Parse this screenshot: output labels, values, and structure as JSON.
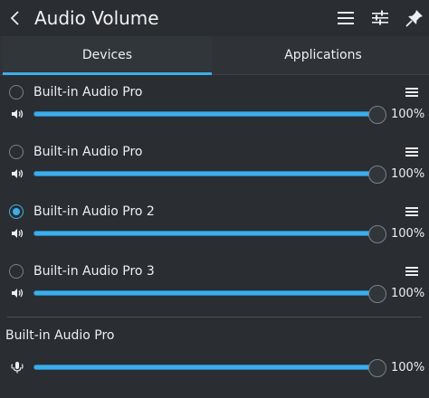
{
  "header": {
    "title": "Audio Volume",
    "back_icon": "chevron-left-icon",
    "actions": [
      {
        "icon": "hamburger-menu-icon"
      },
      {
        "icon": "settings-sliders-icon"
      },
      {
        "icon": "pin-icon"
      }
    ]
  },
  "tabs": [
    {
      "label": "Devices",
      "active": true
    },
    {
      "label": "Applications",
      "active": false
    }
  ],
  "devices": [
    {
      "name": "Built-in Audio Pro",
      "selected": false,
      "volume_percent": 100,
      "volume_label": "100%",
      "icon": "speaker-icon"
    },
    {
      "name": "Built-in Audio Pro",
      "selected": false,
      "volume_percent": 100,
      "volume_label": "100%",
      "icon": "speaker-icon"
    },
    {
      "name": "Built-in Audio Pro 2",
      "selected": true,
      "volume_percent": 100,
      "volume_label": "100%",
      "icon": "speaker-icon"
    },
    {
      "name": "Built-in Audio Pro 3",
      "selected": false,
      "volume_percent": 100,
      "volume_label": "100%",
      "icon": "speaker-icon"
    }
  ],
  "input_source": {
    "name": "Built-in Audio Pro",
    "volume_percent": 100,
    "volume_label": "100%",
    "icon": "microphone-icon"
  },
  "colors": {
    "background": "#2a2e32",
    "accent": "#3daee9",
    "text": "#eceff1"
  }
}
